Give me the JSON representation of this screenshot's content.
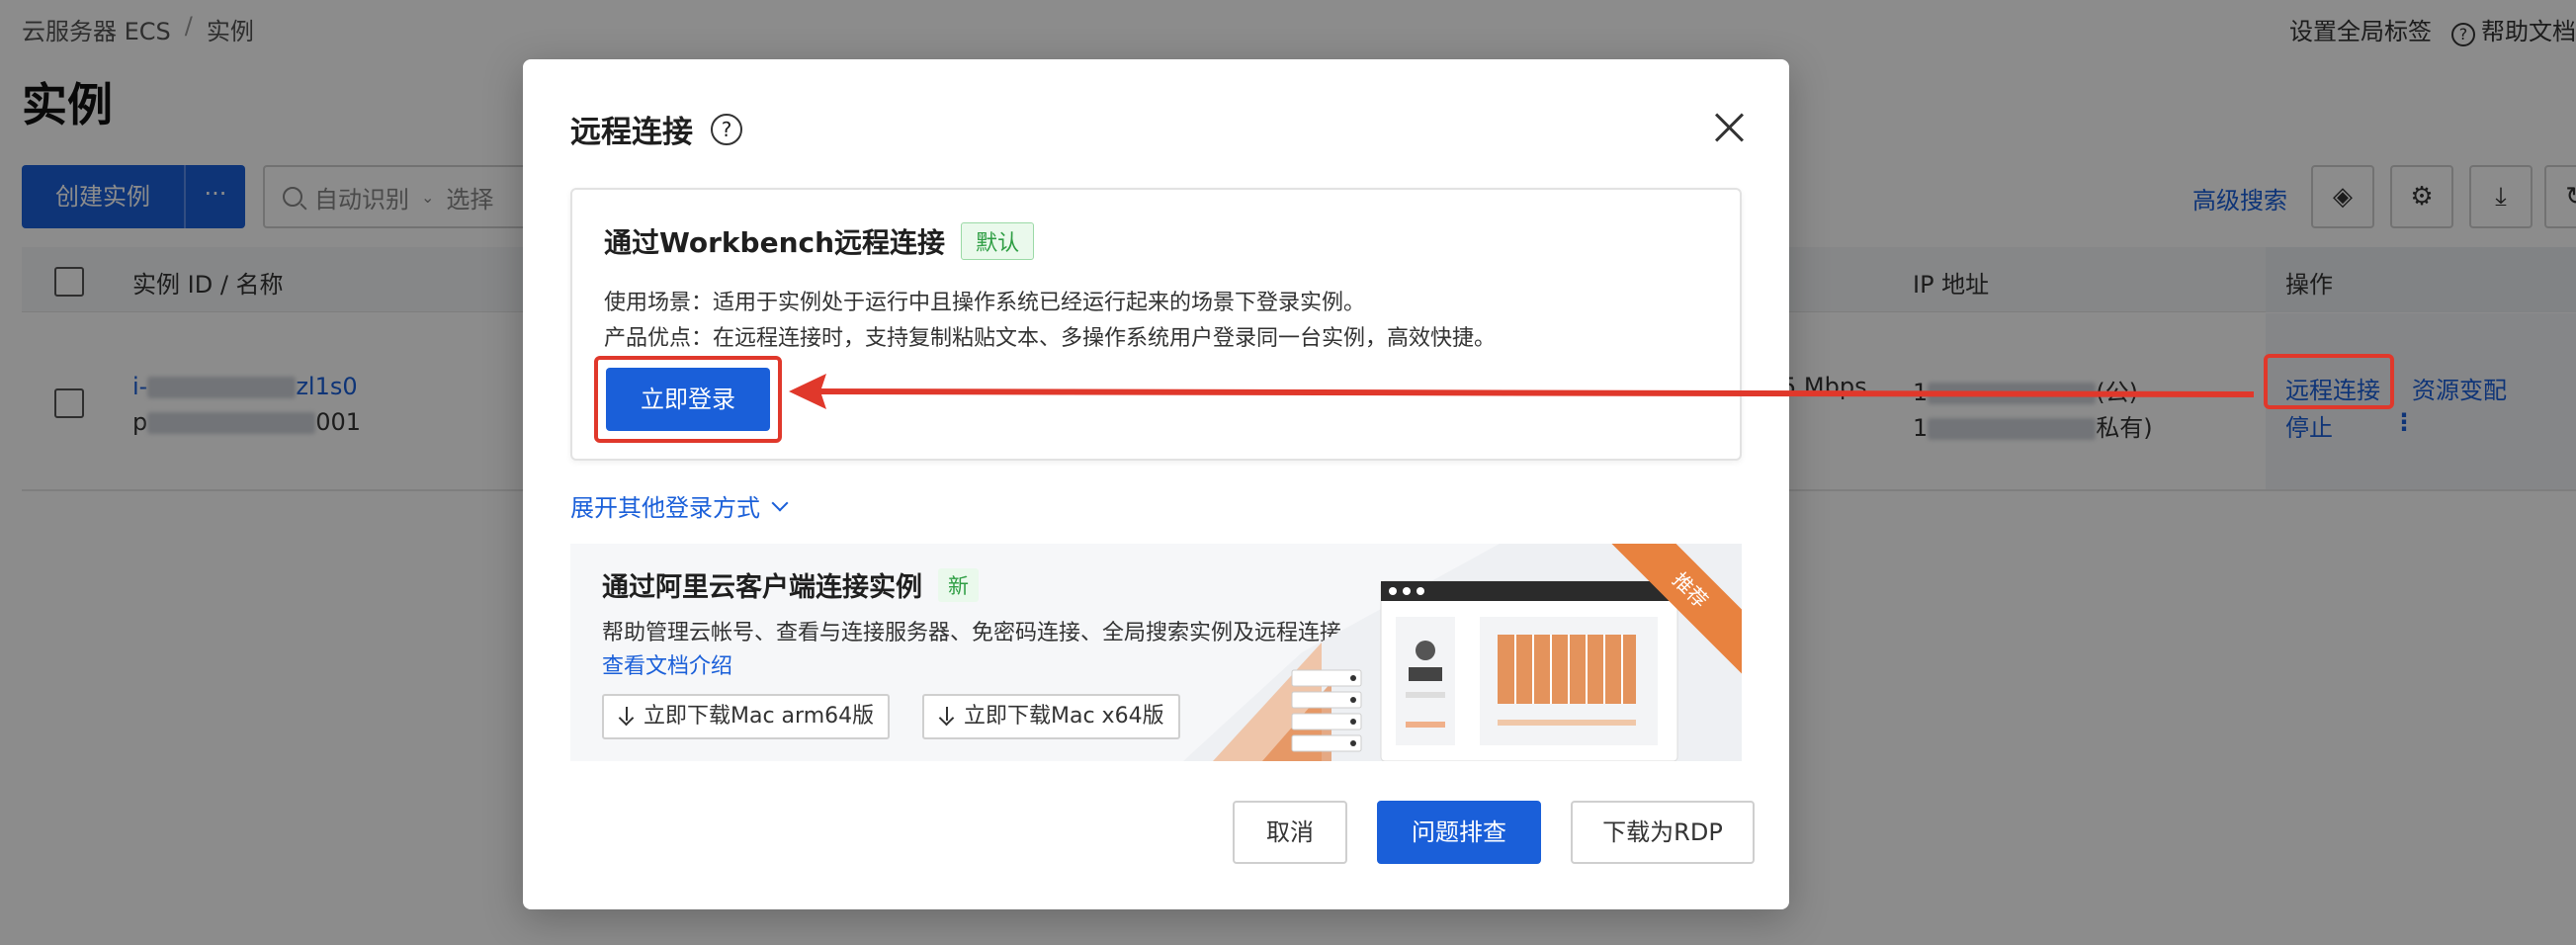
{
  "breadcrumb": {
    "root": "云服务器 ECS",
    "separator": "/",
    "current": "实例"
  },
  "top_right": {
    "set_tags": "设置全局标签",
    "help": "帮助文档"
  },
  "page": {
    "title": "实例"
  },
  "toolbar": {
    "create_label": "创建实例",
    "more_label": "···",
    "search_mode": "自动识别",
    "search_placeholder": "选择",
    "advanced_search": "高级搜索"
  },
  "table": {
    "headers": {
      "id_name": "实例 ID / 名称",
      "ip": "IP 地址",
      "ops": "操作"
    },
    "row": {
      "id_prefix": "i-",
      "id_suffix": "zl1s0",
      "name_prefix": "p",
      "name_suffix": "001",
      "bandwidth": "5 Mbps",
      "ip_public_prefix": "1",
      "ip_public_suffix": "(公)",
      "ip_private_prefix": "1",
      "ip_private_suffix": "私有)",
      "op_remote": "远程连接",
      "op_resize": "资源变配",
      "op_stop": "停止",
      "op_more": "⋮"
    }
  },
  "modal": {
    "title": "远程连接",
    "help_glyph": "?",
    "workbench": {
      "title": "通过Workbench远程连接",
      "tag": "默认",
      "scenario": "使用场景：适用于实例处于运行中且操作系统已经运行起来的场景下登录实例。",
      "advantage": "产品优点：在远程连接时，支持复制粘贴文本、多操作系统用户登录同一台实例，高效快捷。",
      "login_button": "立即登录"
    },
    "expand_label": "展开其他登录方式",
    "client": {
      "title": "通过阿里云客户端连接实例",
      "tag": "新",
      "desc": "帮助管理云帐号、查看与连接服务器、免密码连接、全局搜索实例及远程连接。",
      "doc_link": "查看文档介绍",
      "dl_arm": "立即下载Mac arm64版",
      "dl_x64": "立即下载Mac x64版",
      "ribbon": "推荐"
    },
    "footer": {
      "cancel": "取消",
      "troubleshoot": "问题排查",
      "download_rdp": "下载为RDP"
    }
  },
  "colors": {
    "primary": "#1a5fd9",
    "highlight": "#e0382b",
    "success": "#2f9e44",
    "ribbon": "#e8823f"
  }
}
